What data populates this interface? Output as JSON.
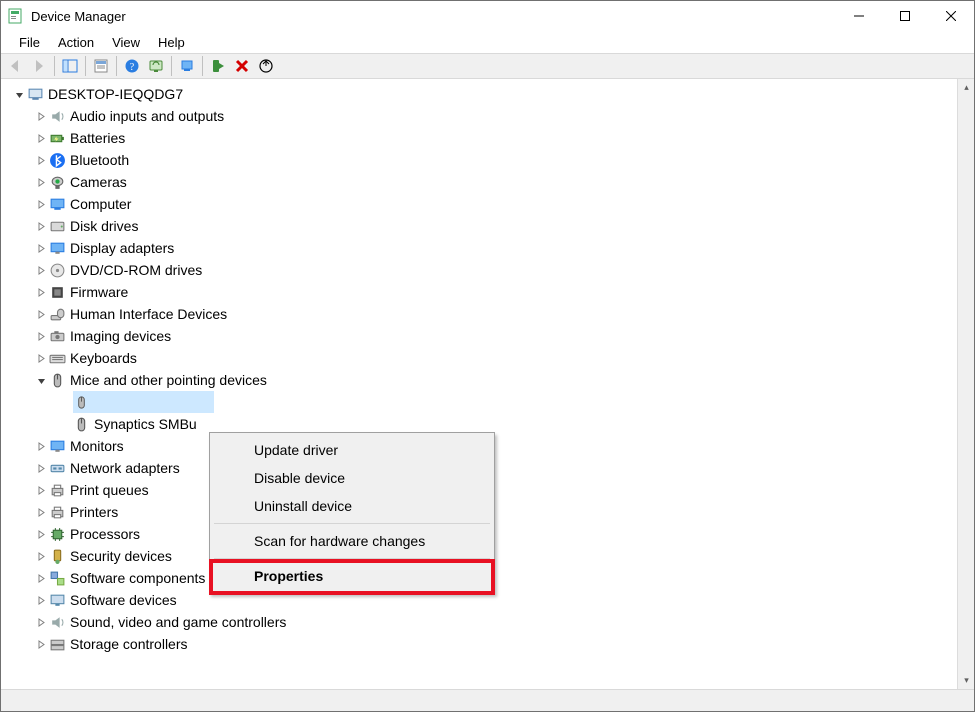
{
  "window": {
    "title": "Device Manager"
  },
  "menu": {
    "file": "File",
    "action": "Action",
    "view": "View",
    "help": "Help"
  },
  "tree": {
    "root": "DESKTOP-IEQQDG7",
    "categories": [
      {
        "label": "Audio inputs and outputs",
        "expanded": false
      },
      {
        "label": "Batteries",
        "expanded": false
      },
      {
        "label": "Bluetooth",
        "expanded": false
      },
      {
        "label": "Cameras",
        "expanded": false
      },
      {
        "label": "Computer",
        "expanded": false
      },
      {
        "label": "Disk drives",
        "expanded": false
      },
      {
        "label": "Display adapters",
        "expanded": false
      },
      {
        "label": "DVD/CD-ROM drives",
        "expanded": false
      },
      {
        "label": "Firmware",
        "expanded": false
      },
      {
        "label": "Human Interface Devices",
        "expanded": false
      },
      {
        "label": "Imaging devices",
        "expanded": false
      },
      {
        "label": "Keyboards",
        "expanded": false
      },
      {
        "label": "Mice and other pointing devices",
        "expanded": true,
        "children": [
          {
            "label": "",
            "selected": true
          },
          {
            "label": "Synaptics SMBu"
          }
        ]
      },
      {
        "label": "Monitors",
        "expanded": false
      },
      {
        "label": "Network adapters",
        "expanded": false
      },
      {
        "label": "Print queues",
        "expanded": false
      },
      {
        "label": "Printers",
        "expanded": false
      },
      {
        "label": "Processors",
        "expanded": false
      },
      {
        "label": "Security devices",
        "expanded": false
      },
      {
        "label": "Software components",
        "expanded": false
      },
      {
        "label": "Software devices",
        "expanded": false
      },
      {
        "label": "Sound, video and game controllers",
        "expanded": false
      },
      {
        "label": "Storage controllers",
        "expanded": false
      }
    ]
  },
  "context_menu": {
    "items": [
      {
        "label": "Update driver"
      },
      {
        "label": "Disable device"
      },
      {
        "label": "Uninstall device"
      }
    ],
    "items2": [
      {
        "label": "Scan for hardware changes"
      }
    ],
    "items3": [
      {
        "label": "Properties",
        "default": true
      }
    ]
  }
}
